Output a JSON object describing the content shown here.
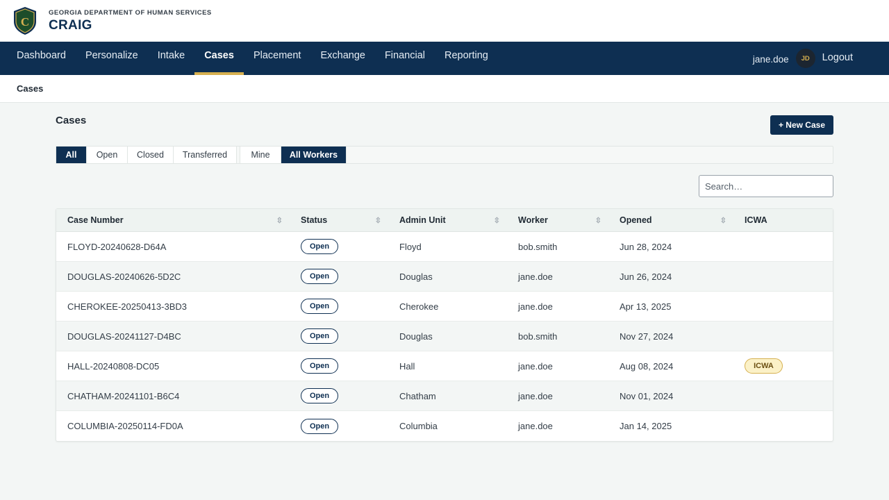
{
  "header": {
    "department": "GEORGIA DEPARTMENT OF HUMAN SERVICES",
    "app_name": "CRAIG",
    "logo_letter": "C",
    "colors": {
      "navy": "#0e2f52",
      "gold": "#d6b050"
    }
  },
  "nav": {
    "items": [
      {
        "label": "Dashboard",
        "active": false
      },
      {
        "label": "Personalize",
        "active": false
      },
      {
        "label": "Intake",
        "active": false
      },
      {
        "label": "Cases",
        "active": true
      },
      {
        "label": "Placement",
        "active": false
      },
      {
        "label": "Exchange",
        "active": false
      },
      {
        "label": "Financial",
        "active": false
      },
      {
        "label": "Reporting",
        "active": false
      }
    ],
    "username": "jane.doe",
    "avatar_initials": "JD",
    "logout_label": "Logout"
  },
  "breadcrumb": {
    "current": "Cases"
  },
  "page": {
    "title": "Cases",
    "new_case_label": "+ New Case"
  },
  "filters": {
    "status": [
      {
        "label": "All",
        "active": true
      },
      {
        "label": "Open",
        "active": false
      },
      {
        "label": "Closed",
        "active": false
      },
      {
        "label": "Transferred",
        "active": false
      }
    ],
    "owner": [
      {
        "label": "Mine",
        "active": false
      },
      {
        "label": "All Workers",
        "active": true
      }
    ]
  },
  "search": {
    "placeholder": "Search…",
    "value": ""
  },
  "table": {
    "columns": [
      "Case Number",
      "Status",
      "Admin Unit",
      "Worker",
      "Opened",
      "ICWA"
    ],
    "rows": [
      {
        "case_number": "FLOYD-20240628-D64A",
        "status": "Open",
        "admin_unit": "Floyd",
        "worker": "bob.smith",
        "opened": "Jun 28, 2024",
        "icwa": ""
      },
      {
        "case_number": "DOUGLAS-20240626-5D2C",
        "status": "Open",
        "admin_unit": "Douglas",
        "worker": "jane.doe",
        "opened": "Jun 26, 2024",
        "icwa": ""
      },
      {
        "case_number": "CHEROKEE-20250413-3BD3",
        "status": "Open",
        "admin_unit": "Cherokee",
        "worker": "jane.doe",
        "opened": "Apr 13, 2025",
        "icwa": ""
      },
      {
        "case_number": "DOUGLAS-20241127-D4BC",
        "status": "Open",
        "admin_unit": "Douglas",
        "worker": "bob.smith",
        "opened": "Nov 27, 2024",
        "icwa": ""
      },
      {
        "case_number": "HALL-20240808-DC05",
        "status": "Open",
        "admin_unit": "Hall",
        "worker": "jane.doe",
        "opened": "Aug 08, 2024",
        "icwa": "ICWA"
      },
      {
        "case_number": "CHATHAM-20241101-B6C4",
        "status": "Open",
        "admin_unit": "Chatham",
        "worker": "jane.doe",
        "opened": "Nov 01, 2024",
        "icwa": ""
      },
      {
        "case_number": "COLUMBIA-20250114-FD0A",
        "status": "Open",
        "admin_unit": "Columbia",
        "worker": "jane.doe",
        "opened": "Jan 14, 2025",
        "icwa": ""
      }
    ]
  }
}
